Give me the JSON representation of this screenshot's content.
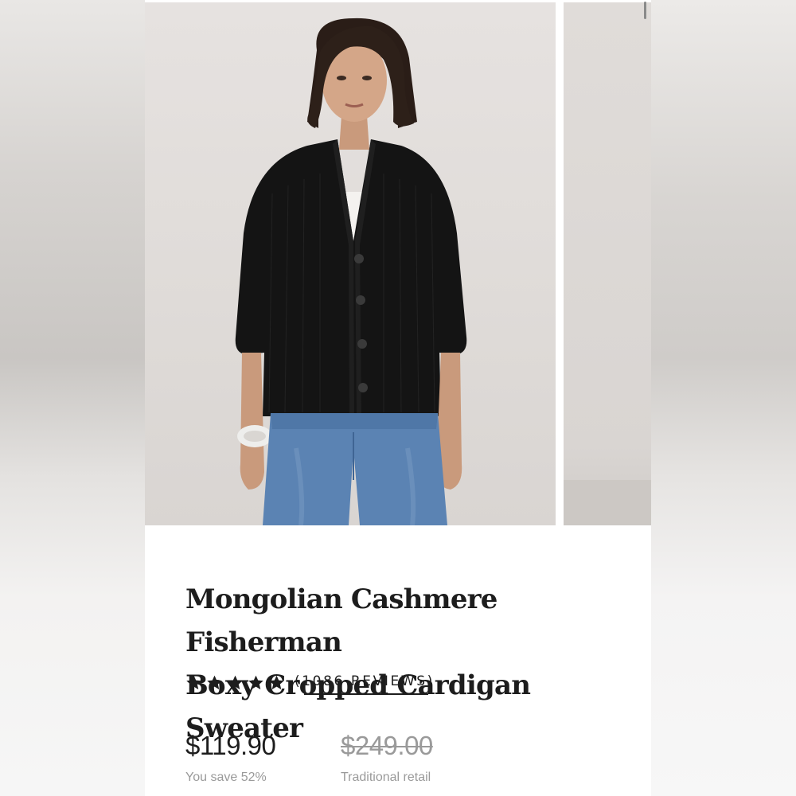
{
  "product": {
    "title_line1": "Mongolian Cashmere Fisherman",
    "title_line2": "Boxy Cropped Cardigan Sweater",
    "rating_stars": 5,
    "reviews_label": "(1086 REVIEWS)"
  },
  "pricing": {
    "current_price": "$119.90",
    "savings_label": "You save 52%",
    "original_price": "$249.00",
    "original_label": "Traditional retail"
  },
  "gallery": {
    "image_count_visible": 2,
    "icons": [
      "product-photo-model",
      "product-photo-next"
    ]
  },
  "colors": {
    "text": "#1d1d1d",
    "muted": "#9a9a9a",
    "sweater": "#141414",
    "denim": "#5b83b3"
  }
}
